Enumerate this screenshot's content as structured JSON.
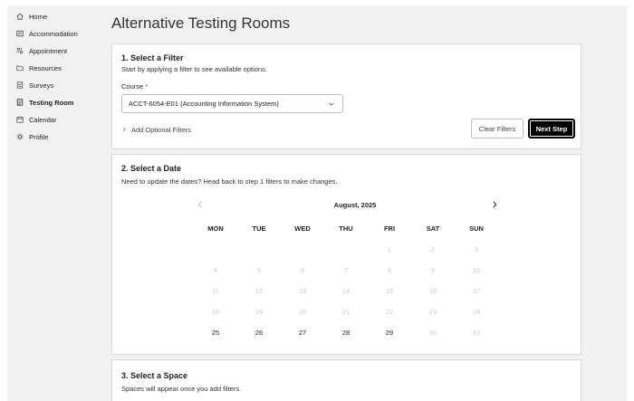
{
  "sidebar": {
    "items": [
      {
        "label": "Home",
        "icon": "home-icon"
      },
      {
        "label": "Accommodation",
        "icon": "accommodation-icon"
      },
      {
        "label": "Appointment",
        "icon": "appointment-icon"
      },
      {
        "label": "Resources",
        "icon": "resources-icon"
      },
      {
        "label": "Surveys",
        "icon": "surveys-icon"
      },
      {
        "label": "Testing Room",
        "icon": "testing-room-icon"
      },
      {
        "label": "Calendar",
        "icon": "calendar-icon"
      },
      {
        "label": "Profile",
        "icon": "profile-icon"
      }
    ],
    "active_index": 5
  },
  "page": {
    "title": "Alternative Testing Rooms"
  },
  "filter": {
    "title": "1. Select a Filter",
    "subtitle": "Start by applying a filter to see available options.",
    "course_label": "Course",
    "required_mark": "*",
    "course_value": "ACCT-6054-E01 (Accounting Information System)",
    "optional_label": "Add Optional Filters",
    "clear_label": "Clear Filters",
    "next_label": "Next Step"
  },
  "date": {
    "title": "2. Select a Date",
    "subtitle": "Need to update the dates? Head back to step 1 filters to make changes.",
    "month": "August, 2025",
    "weekdays": [
      "MON",
      "TUE",
      "WED",
      "THU",
      "FRI",
      "SAT",
      "SUN"
    ],
    "weeks": [
      [
        "",
        "",
        "",
        "",
        "1",
        "2",
        "3"
      ],
      [
        "4",
        "5",
        "6",
        "7",
        "8",
        "9",
        "10"
      ],
      [
        "11",
        "12",
        "13",
        "14",
        "15",
        "16",
        "17"
      ],
      [
        "18",
        "19",
        "20",
        "21",
        "22",
        "23",
        "24"
      ],
      [
        "25",
        "26",
        "27",
        "28",
        "29",
        "30",
        "31"
      ]
    ],
    "available_days": [
      "25",
      "26",
      "27",
      "28",
      "29"
    ]
  },
  "space": {
    "title": "3. Select a Space",
    "subtitle": "Spaces will appear once you add filters."
  },
  "colors": {
    "accent": "#000000",
    "required": "#c8102e",
    "muted_day": "#c9c9c9"
  }
}
